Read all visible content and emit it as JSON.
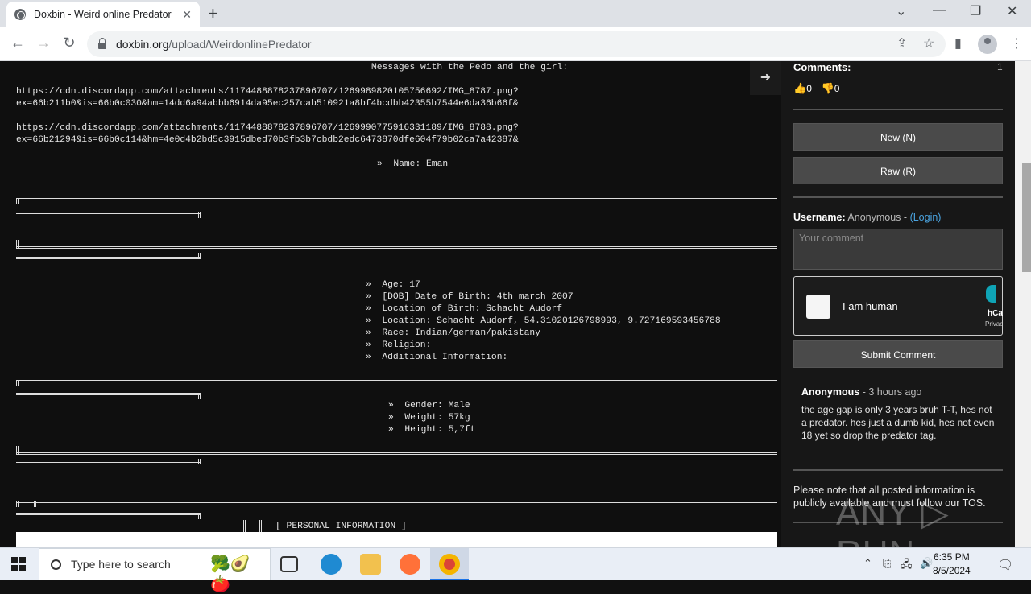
{
  "browser": {
    "tab_title": "Doxbin - Weird online Predator",
    "url_host": "doxbin.org",
    "url_path": "/upload/WeirdonlinePredator"
  },
  "paste": {
    "heading": "Messages with the Pedo and the girl:",
    "link1_a": "https://cdn.discordapp.com/attachments/1174488878237896707/1269989820105756692/IMG_8787.png?",
    "link1_b": "ex=66b211b0&is=66b0c030&hm=14dd6a94abbb6914da95ec257cab510921a8bf4bcdbb42355b7544e6da36b66f&",
    "link2_a": "https://cdn.discordapp.com/attachments/1174488878237896707/1269990775916331189/IMG_8788.png?",
    "link2_b": "ex=66b21294&is=66b0c114&hm=4e0d4b2bd5c3915dbed70b3fb3b7cbdb2edc6473870dfe604f79b02ca7a42387&",
    "name_line": "»  Name: Eman",
    "info_lines": [
      "»  Age: 17",
      "»  [DOB] Date of Birth: 4th march 2007",
      "»  Location of Birth: Schacht Audorf",
      "»  Location: Schacht Audorf, 54.31020126798993, 9.727169593456788",
      "»  Race: Indian/german/pakistany",
      "»  Religion:",
      "»  Additional Information:"
    ],
    "body_lines": [
      "»  Gender: Male",
      "»  Weight: 57kg",
      "»  Height: 5,7ft"
    ],
    "section_title": "[ PERSONAL INFORMATION ]"
  },
  "sidebar": {
    "comments_label": "Comments:",
    "comments_count": "1",
    "likes": "0",
    "dislikes": "0",
    "new_button": "New (N)",
    "raw_button": "Raw (R)",
    "username_label": "Username:",
    "username_value": "Anonymous -",
    "login_link": "(Login)",
    "comment_placeholder": "Your comment",
    "captcha_label": "I am human",
    "captcha_brand": "hCa",
    "captcha_privacy": "Privac",
    "submit_button": "Submit Comment",
    "comment": {
      "author": "Anonymous",
      "time": "- 3 hours ago",
      "text": "the age gap is only 3 years bruh T-T, hes not a predator. hes just a dumb kid, hes not even 18 yet so drop the predator tag."
    },
    "notice": "Please note that all posted information is publicly available and must follow our TOS."
  },
  "watermark": "ANY ▷ RUN",
  "taskbar": {
    "search_placeholder": "Type here to search",
    "time": "6:35 PM",
    "date": "8/5/2024"
  },
  "colors": {
    "page_bg": "#0f0f0f",
    "sidebar_bg": "#171717",
    "button_bg": "#4a4a4a",
    "link": "#4aa3df"
  }
}
